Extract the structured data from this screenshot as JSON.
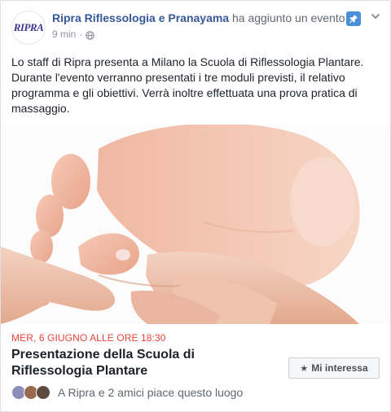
{
  "post": {
    "author": {
      "name": "Ripra Riflessologia e Pranayama",
      "avatar_text": "RIPRA"
    },
    "action_text": "ha aggiunto un evento.",
    "time": "9 min",
    "separator": "·",
    "body": "Lo staff di Ripra presenta a Milano la Scuola di Riflessologia Plantare. Durante l'evento verranno presentati i tre moduli previsti, il relativo programma e gli obiettivi. Verrà inoltre effettuata una prova pratica di massaggio."
  },
  "event": {
    "date": "MER, 6 GIUGNO ALLE ORE 18:30",
    "title": "Presentazione della Scuola di Riflessologia Plantare",
    "interest_label": "Mi interessa",
    "social_text": "A Ripra e 2 amici piace questo luogo"
  },
  "icons": {
    "pin": "pin-icon",
    "menu": "chevron-down-icon",
    "privacy": "globe-icon",
    "interest": "star-icon"
  },
  "colors": {
    "page_name": "#365899",
    "event_date": "#e7443b",
    "pin_bg": "#4a90d9"
  }
}
